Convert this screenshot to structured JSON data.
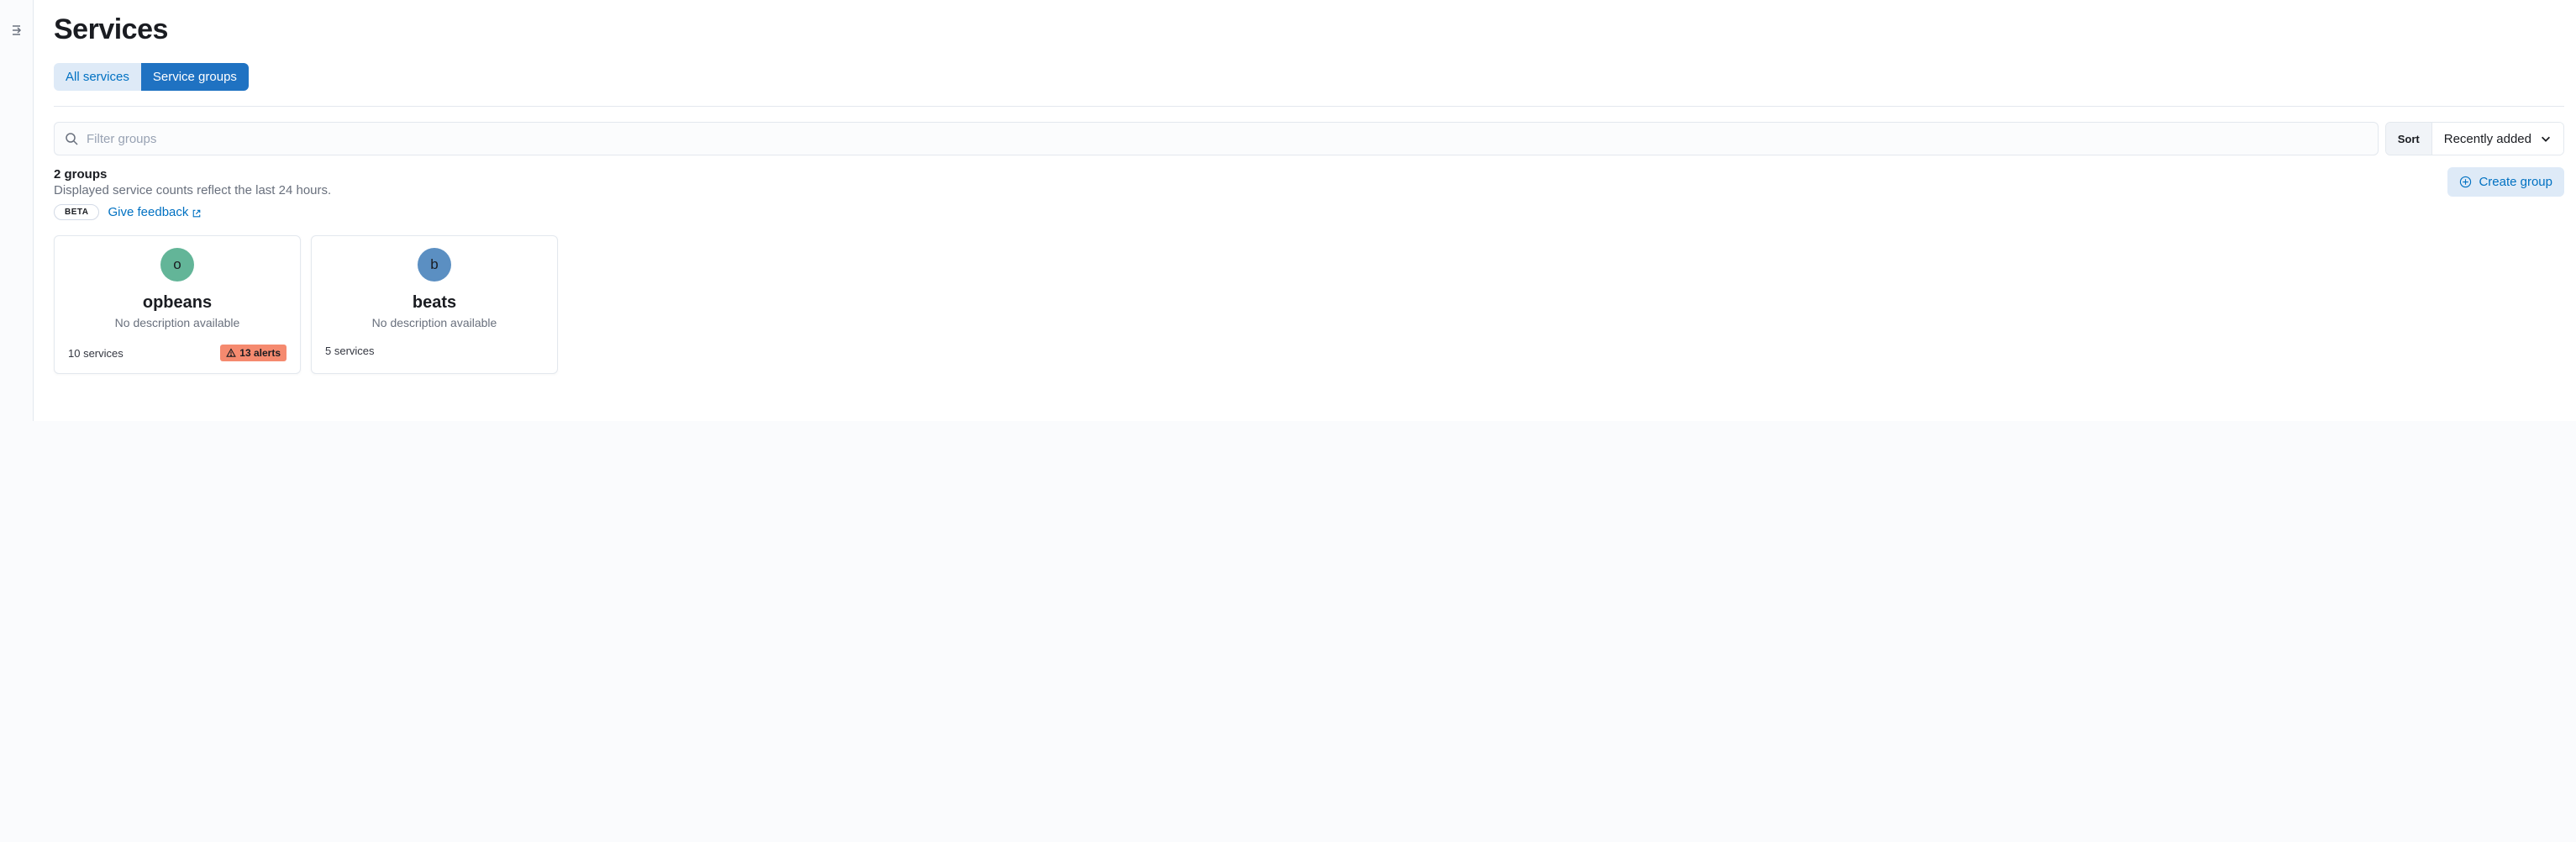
{
  "page": {
    "title": "Services"
  },
  "tabs": {
    "all_services": "All services",
    "service_groups": "Service groups"
  },
  "filter": {
    "placeholder": "Filter groups"
  },
  "sort": {
    "label": "Sort",
    "selected": "Recently added"
  },
  "summary": {
    "count_label": "2 groups",
    "note": "Displayed service counts reflect the last 24 hours."
  },
  "create_group": {
    "label": "Create group"
  },
  "feedback": {
    "badge": "BETA",
    "link": "Give feedback"
  },
  "groups": [
    {
      "initial": "o",
      "avatar_class": "avatar-o",
      "name": "opbeans",
      "description": "No description available",
      "services_label": "10 services",
      "alerts": "13 alerts"
    },
    {
      "initial": "b",
      "avatar_class": "avatar-b",
      "name": "beats",
      "description": "No description available",
      "services_label": "5 services",
      "alerts": null
    }
  ]
}
